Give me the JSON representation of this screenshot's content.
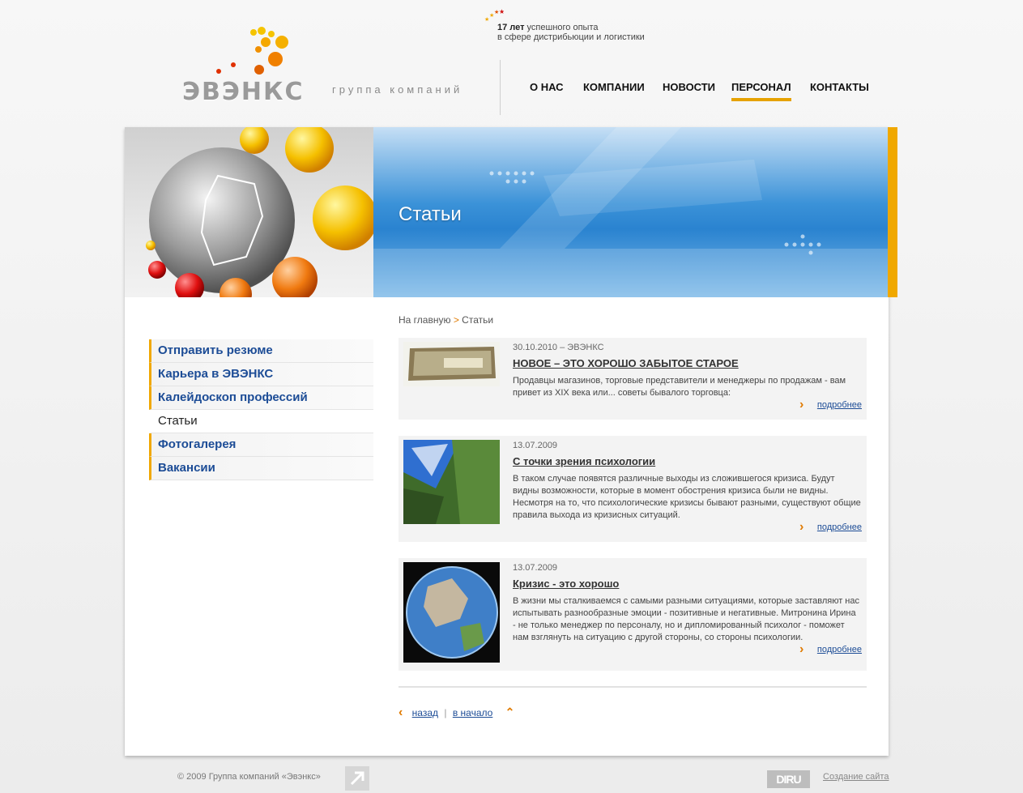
{
  "tagline": {
    "years": "17 лет",
    "line1_rest": " успешного опыта",
    "line2": "в сфере дистрибьюции и логистики"
  },
  "logo": {
    "word": "ЭВЭНКС"
  },
  "subtitle": "группа компаний",
  "nav": [
    {
      "label": "О НАС"
    },
    {
      "label": "КОМПАНИИ"
    },
    {
      "label": "НОВОСТИ"
    },
    {
      "label": "ПЕРСОНАЛ",
      "active": true
    },
    {
      "label": "КОНТАКТЫ"
    }
  ],
  "banner": {
    "title": "Статьи"
  },
  "sidebar": {
    "items": [
      {
        "label": "Отправить резюме"
      },
      {
        "label": "Карьера в ЭВЭНКС"
      },
      {
        "label": "Калейдоскоп профессий"
      },
      {
        "label": "Статьи",
        "current": true
      },
      {
        "label": "Фотогалерея"
      },
      {
        "label": "Вакансии"
      }
    ]
  },
  "breadcrumb": {
    "home": "На главную",
    "separator": ">",
    "current": "Статьи"
  },
  "articles": [
    {
      "date": "30.10.2010 – ЭВЭНКС",
      "title": "НОВОЕ – ЭТО ХОРОШО ЗАБЫТОЕ СТАРОЕ",
      "desc": "Продавцы магазинов, торговые представители и менеджеры по продажам - вам привет из XIX века или... советы бывалого торговца:",
      "more": "подробнее"
    },
    {
      "date": "13.07.2009",
      "title": "С точки зрения психологии",
      "desc": "В таком случае появятся различные выходы из сложившегося кризиса. Будут видны возможности, которые в момент обострения кризиса были не видны. Несмотря на то, что психологические кризисы бывают разными, существуют общие правила выхода из кризисных ситуаций.",
      "more": "подробнее"
    },
    {
      "date": "13.07.2009",
      "title": "Кризис - это хорошо",
      "desc": "В жизни мы сталкиваемся с самыми разными ситуациями, которые заставляют нас испытывать разнообразные эмоции - позитивные и негативные. Митронина Ирина - не только менеджер по персоналу, но и дипломированный психолог - поможет нам взглянуть на ситуацию с другой стороны, со стороны психологии.",
      "more": "подробнее"
    }
  ],
  "pager": {
    "back": "назад",
    "divider": "|",
    "start": "в начало"
  },
  "footer": {
    "copyright": "© 2009 Группа компаний «Эвэнкс»",
    "dir_logo": "DIRU",
    "dev_link": "Создание сайта"
  },
  "colors": {
    "accent": "#f0a800",
    "link": "#1c4c96",
    "chevron": "#e07a00"
  }
}
